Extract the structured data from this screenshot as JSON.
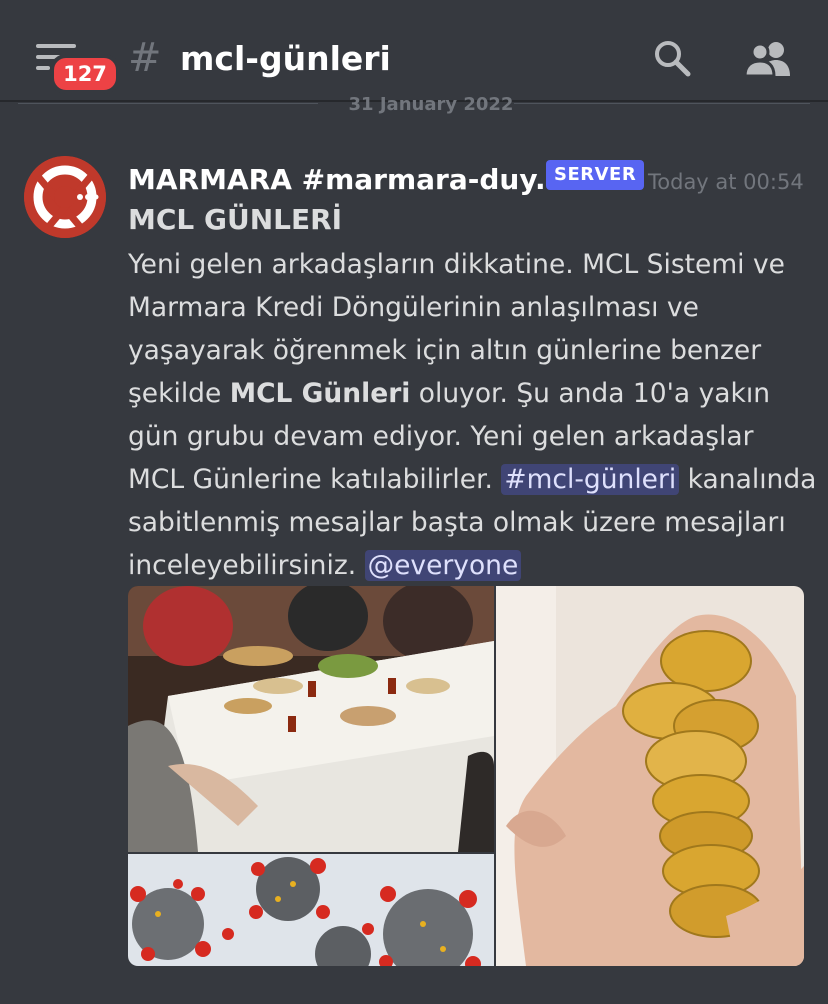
{
  "header": {
    "unread_count": "127",
    "channel_hash": "#",
    "channel_name": "mcl-günleri",
    "icons": [
      "menu-icon",
      "hash-icon",
      "search-icon",
      "members-icon"
    ]
  },
  "divider": {
    "date": "31 January 2022"
  },
  "message": {
    "author": "MARMARA #marmara-duy...",
    "tag": "SERVER",
    "timestamp": "Today at 00:54",
    "title": "MCL GÜNLERİ",
    "body_part1": "Yeni gelen arkadaşların dikkatine. MCL Sistemi ve Marmara Kredi Döngülerinin anlaşılması ve yaşayarak öğrenmek için altın günlerine benzer şekilde ",
    "body_bold": "MCL Günleri",
    "body_part2": " oluyor. Şu anda 10'a yakın gün grubu devam ediyor. Yeni gelen arkadaşlar MCL Günlerine katılabilirler. ",
    "channel_mention": "#mcl-günleri",
    "body_part3": " kanalında sabitlenmiş mesajlar başta olmak üzere mesajları inceleyebilirsiniz.  ",
    "everyone_mention": "@everyone",
    "attachments": [
      "tea-party-table-photo",
      "gold-coins-in-hand-photo",
      "virus-illustration-photo"
    ]
  },
  "colors": {
    "background": "#36393f",
    "badge": "#ed4245",
    "server_tag": "#5865f2",
    "avatar": "#c0392b",
    "mention_bg": "#4a4f8a",
    "muted": "#72767d"
  }
}
